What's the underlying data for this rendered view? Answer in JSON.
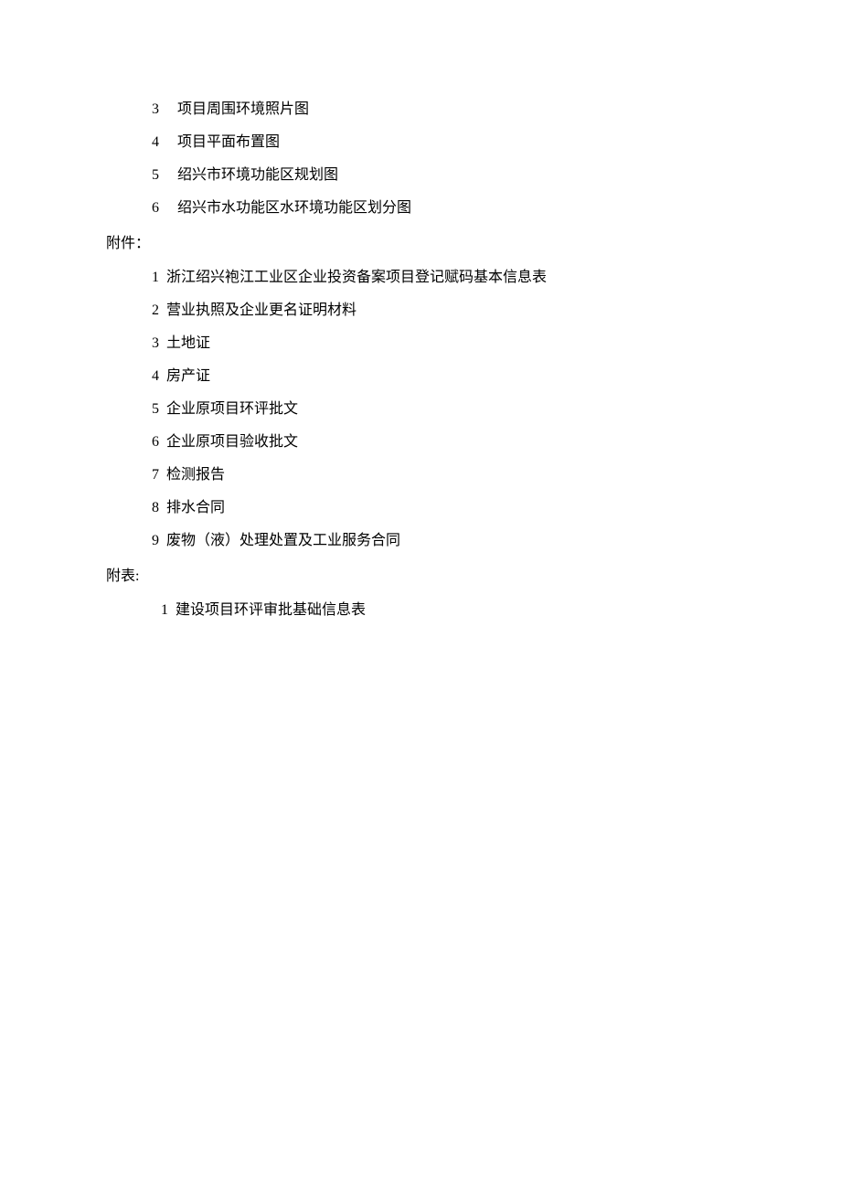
{
  "top_list": [
    {
      "num": "3",
      "text": "项目周围环境照片图"
    },
    {
      "num": "4",
      "text": "项目平面布置图"
    },
    {
      "num": "5",
      "text": "绍兴市环境功能区规划图"
    },
    {
      "num": "6",
      "text": "绍兴市水功能区水环境功能区划分图"
    }
  ],
  "section1_label": "附件：",
  "section1_list": [
    {
      "num": "1",
      "text": "浙江绍兴袍江工业区企业投资备案项目登记赋码基本信息表"
    },
    {
      "num": "2",
      "text": "营业执照及企业更名证明材料"
    },
    {
      "num": "3",
      "text": "土地证"
    },
    {
      "num": "4",
      "text": "房产证"
    },
    {
      "num": "5",
      "text": "企业原项目环评批文"
    },
    {
      "num": "6",
      "text": "企业原项目验收批文"
    },
    {
      "num": "7",
      "text": "检测报告"
    },
    {
      "num": "8",
      "text": "排水合同"
    },
    {
      "num": "9",
      "text": "废物（液）处理处置及工业服务合同"
    }
  ],
  "section2_label": "附表:",
  "section2_list": [
    {
      "num": "1",
      "text": "建设项目环评审批基础信息表"
    }
  ]
}
